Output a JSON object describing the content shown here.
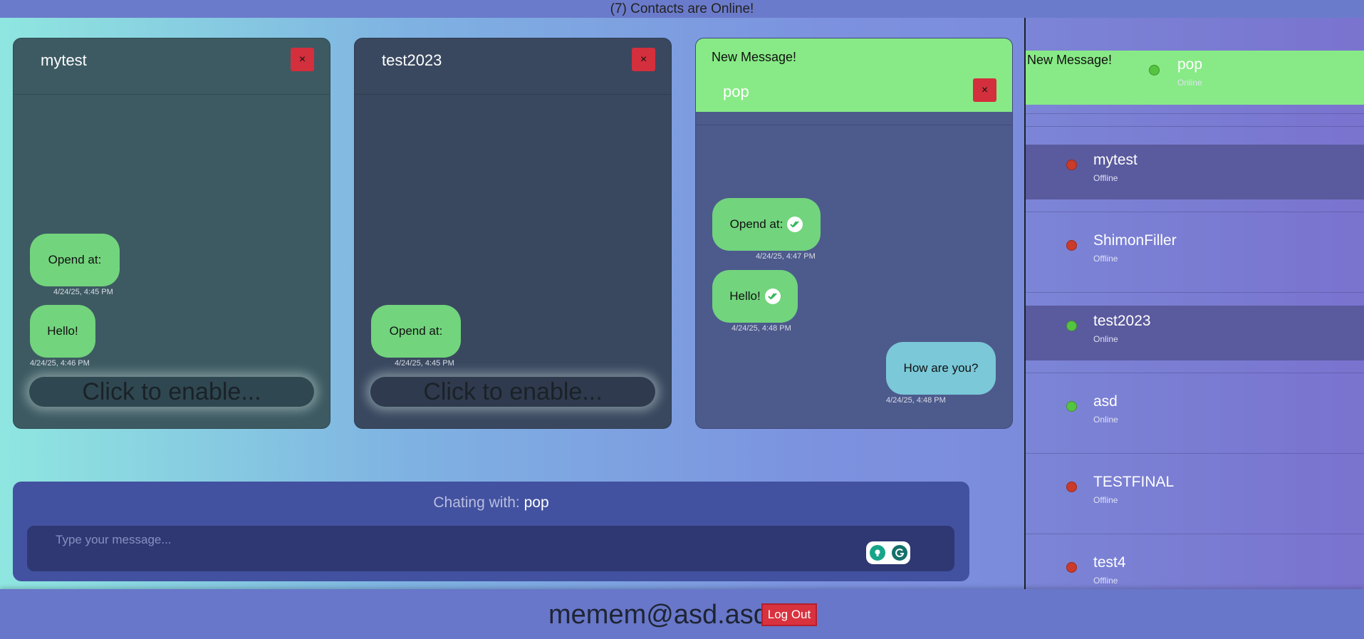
{
  "header": {
    "online_text": "(7) Contacts are Online!"
  },
  "chats": [
    {
      "title": "mytest",
      "close_label": "×",
      "messages": [
        {
          "text": "Opend at:",
          "time": "4/24/25, 4:45 PM"
        },
        {
          "text": "Hello!",
          "time": "4/24/25, 4:46 PM"
        }
      ],
      "enable_text": "Click to enable..."
    },
    {
      "title": "test2023",
      "close_label": "×",
      "messages": [
        {
          "text": "Opend at:",
          "time": "4/24/25, 4:45 PM"
        }
      ],
      "enable_text": "Click to enable..."
    },
    {
      "notice": "New Message!",
      "title": "pop",
      "close_label": "×",
      "messages": [
        {
          "text": "Opend at:",
          "time": "4/24/25, 4:47 PM",
          "read": true
        },
        {
          "text": "Hello!",
          "time": "4/24/25, 4:48 PM",
          "read": true
        },
        {
          "text": "How are you?",
          "time": "4/24/25, 4:48 PM",
          "sent": true
        }
      ]
    }
  ],
  "compose": {
    "label": "Chating with: ",
    "partner": "pop",
    "placeholder": "Type your message..."
  },
  "sidebar": {
    "notice": "New Message!",
    "contacts": [
      {
        "name": "pop",
        "status": "Online"
      },
      {
        "name": "mytest",
        "status": "Offline"
      },
      {
        "name": "ShimonFiller",
        "status": "Offline"
      },
      {
        "name": "test2023",
        "status": "Online"
      },
      {
        "name": "asd",
        "status": "Online"
      },
      {
        "name": "TESTFINAL",
        "status": "Offline"
      },
      {
        "name": "test4",
        "status": "Offline"
      }
    ]
  },
  "footer": {
    "email": "memem@asd.asd",
    "logout_label": "Log Out"
  },
  "colors": {
    "online": "#55c441",
    "offline": "#cc3a2a",
    "new_message": "#88ea86",
    "bubble": "#72d47d",
    "sent_bubble": "#7ac8d8"
  }
}
